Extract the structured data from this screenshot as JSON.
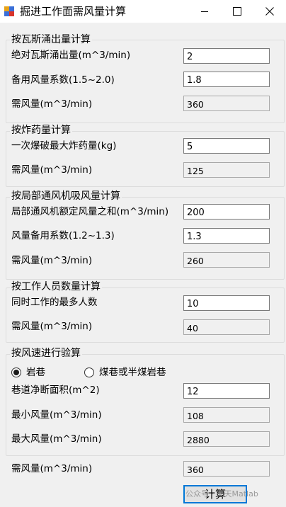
{
  "window": {
    "title": "掘进工作面需风量计算"
  },
  "gas": {
    "title": "按瓦斯涌出量计算",
    "abs_label": "绝对瓦斯涌出量(m^3/min)",
    "abs_value": "2",
    "coef_label": "备用风量系数(1.5~2.0)",
    "coef_value": "1.8",
    "need_label": "需风量(m^3/min)",
    "need_value": "360"
  },
  "explosive": {
    "title": "按炸药量计算",
    "max_label": "一次爆破最大炸药量(kg)",
    "max_value": "5",
    "need_label": "需风量(m^3/min)",
    "need_value": "125"
  },
  "local_fan": {
    "title": "按局部通风机吸风量计算",
    "rated_label": "局部通风机额定风量之和(m^3/min)",
    "rated_value": "200",
    "coef_label": "风量备用系数(1.2~1.3)",
    "coef_value": "1.3",
    "need_label": "需风量(m^3/min)",
    "need_value": "260"
  },
  "personnel": {
    "title": "按工作人员数量计算",
    "max_label": "同时工作的最多人数",
    "max_value": "10",
    "need_label": "需风量(m^3/min)",
    "need_value": "40"
  },
  "velocity": {
    "title": "按风速进行验算",
    "radio_rock": "岩巷",
    "radio_coal": "煤巷或半煤岩巷",
    "selected": "rock",
    "area_label": "巷道净断面积(m^2)",
    "area_value": "12",
    "min_label": "最小风量(m^3/min)",
    "min_value": "108",
    "max_label": "最大风量(m^3/min)",
    "max_value": "2880"
  },
  "result": {
    "need_label": "需风量(m^3/min)",
    "need_value": "360"
  },
  "calc_button": {
    "label": "计算"
  },
  "watermark": {
    "text": "公众号 · 天天Matlab"
  }
}
